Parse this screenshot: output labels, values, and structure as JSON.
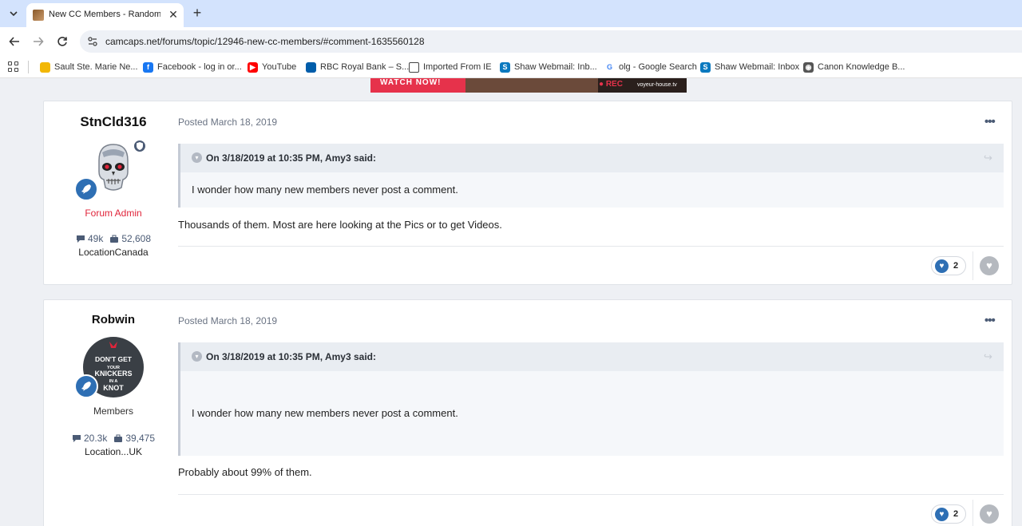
{
  "browser": {
    "tab_title": "New CC Members - Random Di",
    "tab_close": "✕",
    "new_tab": "+",
    "url": "camcaps.net/forums/topic/12946-new-cc-members/#comment-1635560128",
    "bookmarks": [
      {
        "label": "Sault Ste. Marie Ne...",
        "icon": "news-icon",
        "color": "#f2b705",
        "glyph": ""
      },
      {
        "label": "Facebook - log in or...",
        "icon": "facebook-icon",
        "color": "#1877f2",
        "glyph": "f"
      },
      {
        "label": "YouTube",
        "icon": "youtube-icon",
        "color": "#ff0000",
        "glyph": "▶"
      },
      {
        "label": "RBC Royal Bank – S...",
        "icon": "rbc-icon",
        "color": "#005daa",
        "glyph": ""
      },
      {
        "label": "Imported From IE",
        "icon": "folder-icon",
        "color": "#ffffff",
        "glyph": ""
      },
      {
        "label": "Shaw Webmail: Inb...",
        "icon": "shaw-icon",
        "color": "#0b79bf",
        "glyph": "S"
      },
      {
        "label": "olg - Google Search",
        "icon": "google-icon",
        "color": "#ffffff",
        "glyph": "G"
      },
      {
        "label": "Shaw Webmail: Inbox",
        "icon": "shaw-icon",
        "color": "#0b79bf",
        "glyph": "S"
      },
      {
        "label": "Canon Knowledge B...",
        "icon": "globe-icon",
        "color": "#555555",
        "glyph": "◉"
      }
    ]
  },
  "banner": {
    "cta": "WATCH NOW!",
    "rec": "● REC",
    "site": "voyeur-house.tv"
  },
  "posts": [
    {
      "author": "StnCld316",
      "group": "Forum Admin",
      "group_color": "#e0243a",
      "stats": {
        "comments": "49k",
        "reputation": "52,608"
      },
      "location": "LocationCanada",
      "posted": "Posted March 18, 2019",
      "quote": {
        "cite": "On 3/18/2019 at 10:35 PM, Amy3 said:",
        "body": "I wonder how many new members never post a comment."
      },
      "text": "Thousands of them. Most are here looking at the Pics or to get Videos.",
      "reactions": "2"
    },
    {
      "author": "Robwin",
      "group": "Members",
      "group_color": "#333333",
      "stats": {
        "comments": "20.3k",
        "reputation": "39,475"
      },
      "location": "Location...UK",
      "avatar_text": [
        "DON'T GET",
        "YOUR",
        "KNICKERS",
        "IN A",
        "KNOT"
      ],
      "posted": "Posted March 18, 2019",
      "quote": {
        "cite": "On 3/18/2019 at 10:35 PM, Amy3 said:",
        "body": "I wonder how many new members never post a comment."
      },
      "text": "Probably about 99% of them.",
      "reactions": "2"
    }
  ],
  "icons": {
    "more": "•••",
    "rank": "🚀",
    "heart": "♥",
    "share": "↪",
    "chevron": "▾",
    "comment": "💬",
    "reputation": "♟"
  }
}
